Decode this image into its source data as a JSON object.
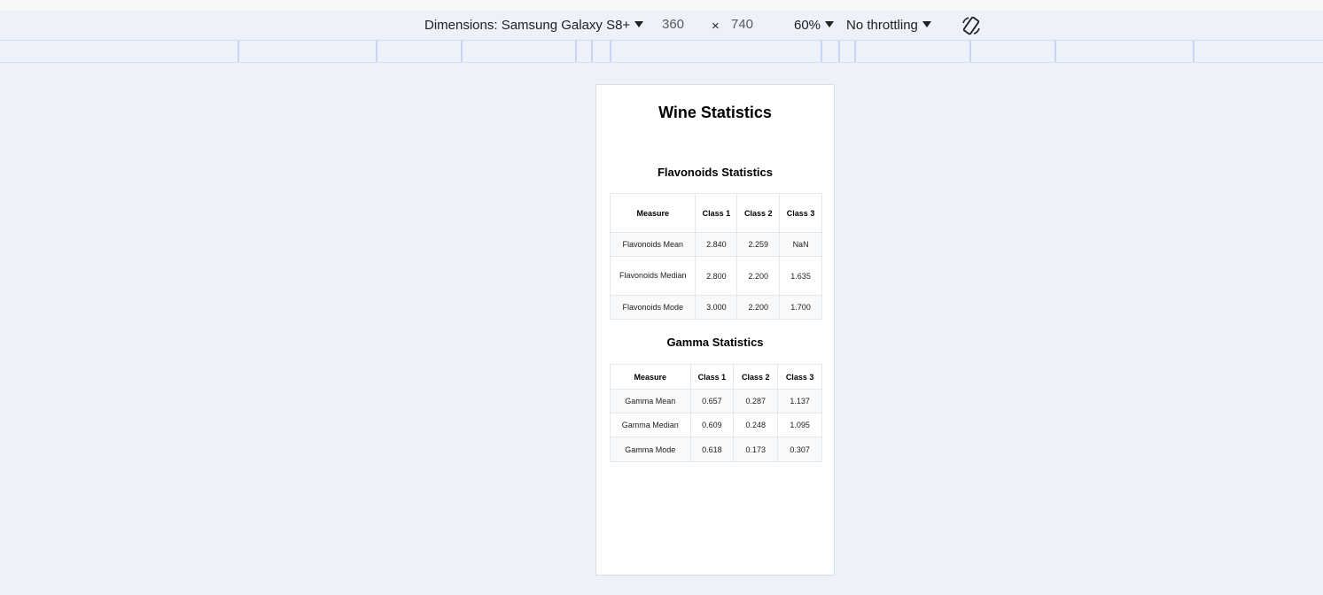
{
  "toolbar": {
    "dimensions_label": "Dimensions: Samsung Galaxy S8+",
    "width": "360",
    "times": "×",
    "height": "740",
    "zoom": "60%",
    "throttling": "No throttling",
    "rotate_icon": "rotate-icon",
    "caret_icon": "caret-down-icon"
  },
  "page": {
    "title": "Wine Statistics",
    "flavonoids": {
      "title": "Flavonoids Statistics",
      "headers": [
        "Measure",
        "Class 1",
        "Class 2",
        "Class 3"
      ],
      "rows": [
        [
          "Flavonoids Mean",
          "2.840",
          "2.259",
          "NaN"
        ],
        [
          "Flavonoids Median",
          "2.800",
          "2.200",
          "1.635"
        ],
        [
          "Flavonoids Mode",
          "3.000",
          "2.200",
          "1.700"
        ]
      ]
    },
    "gamma": {
      "title": "Gamma Statistics",
      "headers": [
        "Measure",
        "Class 1",
        "Class 2",
        "Class 3"
      ],
      "rows": [
        [
          "Gamma Mean",
          "0.657",
          "0.287",
          "1.137"
        ],
        [
          "Gamma Median",
          "0.609",
          "0.248",
          "1.095"
        ],
        [
          "Gamma Mode",
          "0.618",
          "0.173",
          "0.307"
        ]
      ]
    }
  },
  "colors": {
    "background": "#edf1f9",
    "device": "#ffffff",
    "ruler_tick": "#c7d6f0"
  }
}
